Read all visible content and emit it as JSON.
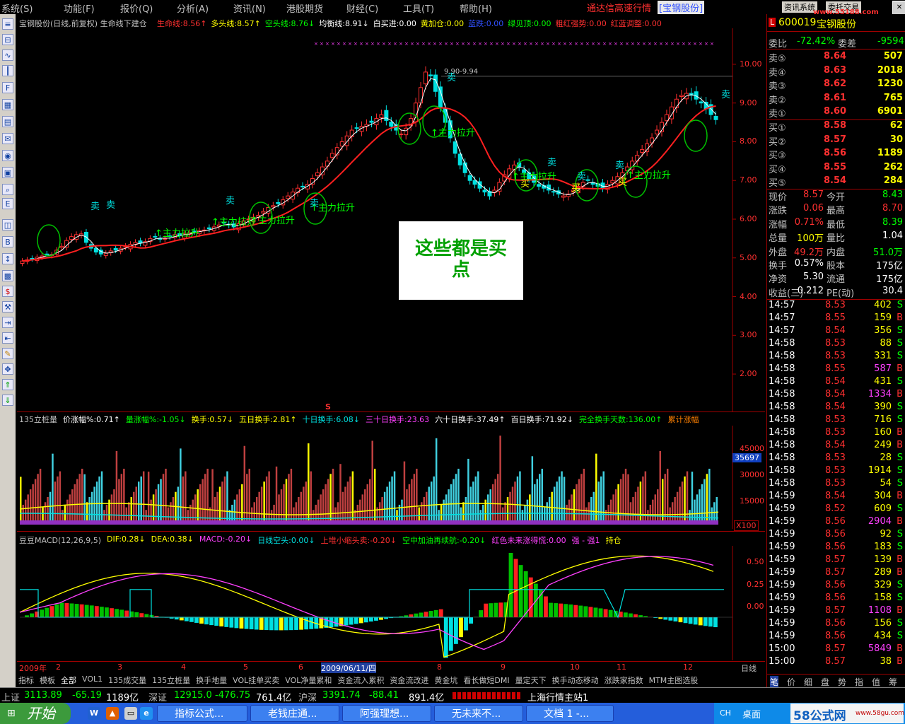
{
  "menu": {
    "items": [
      "系统(S)",
      "功能(F)",
      "报价(Q)",
      "分析(A)",
      "资讯(N)",
      "港股期货",
      "财经(C)",
      "工具(T)",
      "帮助(H)"
    ],
    "brand": "通达信高速行情",
    "stock_tag": "[宝钢股份]",
    "top_buttons": [
      "资讯系统",
      "委托交易"
    ],
    "watermark": "www.55188.com"
  },
  "colors": {
    "up": "#ff3030",
    "down": "#00e0e0",
    "bg": "#000000",
    "ma_yellow": "#ffff00",
    "life_line": "#ff2020"
  },
  "main_chart": {
    "header": "宝钢股份(日线,前复权) 生命线下建仓",
    "indicators": [
      {
        "text": "生命线:8.56↑",
        "color": "#ff3030"
      },
      {
        "text": "多头线:8.57↑",
        "color": "#ffff00"
      },
      {
        "text": "空头线:8.76↓",
        "color": "#00ff00"
      },
      {
        "text": "均衡线:8.91↓",
        "color": "#ffffff"
      },
      {
        "text": "白买进:0.00",
        "color": "#ffffff"
      },
      {
        "text": "黄加仓:0.00",
        "color": "#ffff00"
      },
      {
        "text": "蓝跌:0.00",
        "color": "#3050ff"
      },
      {
        "text": "绿见顶:0.00",
        "color": "#00ff00"
      },
      {
        "text": "粗红强势:0.00",
        "color": "#ff3030"
      },
      {
        "text": "红蓝调整:0.00",
        "color": "#ff3030"
      }
    ],
    "y_ticks": [
      "10.00",
      "9.00",
      "8.00",
      "7.00",
      "6.00",
      "5.00",
      "4.00",
      "3.00",
      "2.00"
    ],
    "peak_label": "9.90-9.94",
    "annotation": [
      "这些都是买",
      "点"
    ],
    "labels": {
      "main_up": "主力拉升",
      "sell": "卖",
      "buy": "买",
      "s_marker": "S"
    }
  },
  "chart_data": [
    {
      "type": "candlestick",
      "title": "宝钢股份(日线,前复权)",
      "ylim": [
        1.8,
        10.2
      ],
      "closes": [
        4.92,
        4.95,
        4.98,
        5.02,
        5.05,
        5.1,
        5.08,
        5.2,
        5.3,
        5.45,
        5.55,
        5.6,
        5.62,
        5.4,
        5.25,
        5.15,
        5.1,
        5.12,
        5.18,
        5.2,
        5.25,
        5.3,
        5.35,
        5.4,
        5.38,
        5.42,
        5.5,
        5.55,
        5.48,
        5.5,
        5.55,
        5.6,
        5.58,
        5.62,
        5.65,
        5.68,
        5.7,
        5.72,
        5.75,
        5.8,
        5.85,
        5.9,
        5.85,
        5.8,
        5.88,
        5.95,
        6.0,
        6.05,
        6.1,
        6.2,
        6.3,
        6.35,
        6.4,
        6.5,
        6.6,
        6.7,
        6.8,
        6.85,
        6.9,
        7.05,
        7.2,
        7.35,
        7.5,
        7.7,
        7.85,
        8.0,
        8.15,
        8.3,
        8.35,
        8.4,
        8.45,
        8.5,
        8.6,
        8.7,
        8.55,
        8.4,
        8.3,
        8.2,
        8.35,
        8.6,
        9.0,
        9.4,
        9.8,
        9.7,
        9.3,
        8.9,
        8.5,
        8.1,
        7.7,
        7.4,
        7.2,
        7.0,
        6.9,
        6.8,
        6.7,
        6.6,
        6.75,
        6.95,
        7.15,
        7.3,
        7.4,
        7.35,
        7.2,
        7.05,
        6.95,
        6.85,
        6.8,
        6.75,
        6.7,
        6.65,
        6.6,
        6.65,
        6.75,
        6.85,
        6.95,
        7.0,
        6.9,
        6.85,
        6.8,
        6.9,
        7.0,
        7.1,
        7.2,
        7.35,
        7.5,
        7.65,
        7.8,
        7.95,
        8.1,
        8.3,
        8.5,
        8.7,
        8.9,
        9.1,
        9.2,
        9.25,
        9.2,
        9.1,
        9.0,
        8.85,
        8.7,
        8.57
      ],
      "ma_fast_label": "多头线",
      "life_line_label": "生命线"
    },
    {
      "type": "bar",
      "title": "135立桩量",
      "ylim": [
        0,
        50000
      ],
      "y_ticks": [
        "45000",
        "30000",
        "15000"
      ],
      "current_value": "35697",
      "scale_label": "X100"
    },
    {
      "type": "bar",
      "title": "豆豆MACD(12,26,9,5)",
      "ylim": [
        -0.35,
        0.65
      ],
      "y_ticks": [
        "0.50",
        "0.25",
        "0.00"
      ]
    }
  ],
  "volume_panel": {
    "header": [
      {
        "text": "135立桩量",
        "color": "#c0c0c0"
      },
      {
        "text": "价涨幅%:0.71↑",
        "color": "#ffffff"
      },
      {
        "text": "量涨幅%:-1.05↓",
        "color": "#00ff00"
      },
      {
        "text": "换手:0.57↓",
        "color": "#ffff00"
      },
      {
        "text": "五日换手:2.81↑",
        "color": "#ffff00"
      },
      {
        "text": "十日换手:6.08↓",
        "color": "#00e0e0"
      },
      {
        "text": "三十日换手:23.63",
        "color": "#ff40ff"
      },
      {
        "text": "六十日换手:37.49↑",
        "color": "#ffffff"
      },
      {
        "text": "百日换手:71.92↓",
        "color": "#ffffff"
      },
      {
        "text": "完全换手天数:136.00↑",
        "color": "#00ff00"
      },
      {
        "text": "累计涨幅",
        "color": "#ff8000"
      }
    ]
  },
  "macd_panel": {
    "header": [
      {
        "text": "豆豆MACD(12,26,9,5)",
        "color": "#c0c0c0"
      },
      {
        "text": "DIF:0.28↓",
        "color": "#ffff00"
      },
      {
        "text": "DEA:0.38↓",
        "color": "#ffff00"
      },
      {
        "text": "MACD:-0.20↓",
        "color": "#ff40ff"
      },
      {
        "text": "日线空头:0.00↓",
        "color": "#00e0e0"
      },
      {
        "text": "上堆小缩头卖:-0.20↓",
        "color": "#ff3030"
      },
      {
        "text": "空中加油再续航:-0.20↓",
        "color": "#00ff00"
      },
      {
        "text": "红色未来涨得慌:0.00",
        "color": "#ff40ff"
      },
      {
        "text": "强 - 强1",
        "color": "#ff40ff"
      },
      {
        "text": "持仓",
        "color": "#ffff00"
      }
    ]
  },
  "x_axis": {
    "labels": [
      "2009年",
      "2",
      "3",
      "4",
      "5",
      "6",
      "2009/06/11/四",
      "8",
      "9",
      "10",
      "11",
      "12"
    ],
    "period": "日线"
  },
  "bottom_tabs": [
    "指标",
    "模板",
    "全部",
    "VOL1",
    "135成交量",
    "135立桩量",
    "换手地量",
    "VOL挂单买卖",
    "VOL净量累和",
    "资金流入累积",
    "资金流改进",
    "黄金坑",
    "看长做短DMI",
    "量定天下",
    "换手动态移动",
    "涨跌家指数",
    "MTM主图选股"
  ],
  "right_panel": {
    "code": "600019",
    "name": "宝钢股份",
    "weibi": {
      "label": "委比",
      "value": "-72.42%",
      "label2": "委差",
      "value2": "-9594"
    },
    "asks": [
      {
        "label": "卖⑤",
        "price": "8.64",
        "vol": "507"
      },
      {
        "label": "卖④",
        "price": "8.63",
        "vol": "2018"
      },
      {
        "label": "卖③",
        "price": "8.62",
        "vol": "1230"
      },
      {
        "label": "卖②",
        "price": "8.61",
        "vol": "765"
      },
      {
        "label": "卖①",
        "price": "8.60",
        "vol": "6901"
      }
    ],
    "bids": [
      {
        "label": "买①",
        "price": "8.58",
        "vol": "62"
      },
      {
        "label": "买②",
        "price": "8.57",
        "vol": "30"
      },
      {
        "label": "买③",
        "price": "8.56",
        "vol": "1189"
      },
      {
        "label": "买④",
        "price": "8.55",
        "vol": "262"
      },
      {
        "label": "买⑤",
        "price": "8.54",
        "vol": "284"
      }
    ],
    "stats": [
      {
        "l1": "现价",
        "v1": "8.57",
        "c1": "#ff3030",
        "l2": "今开",
        "v2": "8.43",
        "c2": "#00ff00"
      },
      {
        "l1": "涨跌",
        "v1": "0.06",
        "c1": "#ff3030",
        "l2": "最高",
        "v2": "8.70",
        "c2": "#ff3030"
      },
      {
        "l1": "涨幅",
        "v1": "0.71%",
        "c1": "#ff3030",
        "l2": "最低",
        "v2": "8.39",
        "c2": "#00ff00"
      },
      {
        "l1": "总量",
        "v1": "100万",
        "c1": "#ffff00",
        "l2": "量比",
        "v2": "1.04",
        "c2": "#ffffff"
      },
      {
        "l1": "外盘",
        "v1": "49.2万",
        "c1": "#ff3030",
        "l2": "内盘",
        "v2": "51.0万",
        "c2": "#00ff00"
      },
      {
        "l1": "换手",
        "v1": "0.57%",
        "c1": "#ffffff",
        "l2": "股本",
        "v2": "175亿",
        "c2": "#ffffff"
      },
      {
        "l1": "净资",
        "v1": "5.30",
        "c1": "#ffffff",
        "l2": "流通",
        "v2": "175亿",
        "c2": "#ffffff"
      },
      {
        "l1": "收益(三)",
        "v1": "0.212",
        "c1": "#ffffff",
        "l2": "PE(动)",
        "v2": "30.4",
        "c2": "#ffffff"
      }
    ],
    "ticks": [
      {
        "t": "14:57",
        "p": "8.53",
        "v": "402",
        "s": "S"
      },
      {
        "t": "14:57",
        "p": "8.55",
        "v": "159",
        "s": "B"
      },
      {
        "t": "14:57",
        "p": "8.54",
        "v": "356",
        "s": "S"
      },
      {
        "t": "14:58",
        "p": "8.53",
        "v": "88",
        "s": "S"
      },
      {
        "t": "14:58",
        "p": "8.53",
        "v": "331",
        "s": "S"
      },
      {
        "t": "14:58",
        "p": "8.55",
        "v": "587",
        "s": "B"
      },
      {
        "t": "14:58",
        "p": "8.54",
        "v": "431",
        "s": "S"
      },
      {
        "t": "14:58",
        "p": "8.54",
        "v": "1334",
        "s": "B"
      },
      {
        "t": "14:58",
        "p": "8.54",
        "v": "390",
        "s": "S"
      },
      {
        "t": "14:58",
        "p": "8.53",
        "v": "716",
        "s": "S"
      },
      {
        "t": "14:58",
        "p": "8.53",
        "v": "160",
        "s": "B"
      },
      {
        "t": "14:58",
        "p": "8.54",
        "v": "249",
        "s": "B"
      },
      {
        "t": "14:58",
        "p": "8.53",
        "v": "28",
        "s": "S"
      },
      {
        "t": "14:58",
        "p": "8.53",
        "v": "1914",
        "s": "S"
      },
      {
        "t": "14:58",
        "p": "8.53",
        "v": "54",
        "s": "S"
      },
      {
        "t": "14:59",
        "p": "8.54",
        "v": "304",
        "s": "B"
      },
      {
        "t": "14:59",
        "p": "8.52",
        "v": "609",
        "s": "S"
      },
      {
        "t": "14:59",
        "p": "8.56",
        "v": "2904",
        "s": "B"
      },
      {
        "t": "14:59",
        "p": "8.56",
        "v": "92",
        "s": "S"
      },
      {
        "t": "14:59",
        "p": "8.56",
        "v": "183",
        "s": "S"
      },
      {
        "t": "14:59",
        "p": "8.57",
        "v": "139",
        "s": "B"
      },
      {
        "t": "14:59",
        "p": "8.57",
        "v": "289",
        "s": "B"
      },
      {
        "t": "14:59",
        "p": "8.56",
        "v": "329",
        "s": "S"
      },
      {
        "t": "14:59",
        "p": "8.56",
        "v": "158",
        "s": "S"
      },
      {
        "t": "14:59",
        "p": "8.57",
        "v": "1108",
        "s": "B"
      },
      {
        "t": "14:59",
        "p": "8.56",
        "v": "156",
        "s": "S"
      },
      {
        "t": "14:59",
        "p": "8.56",
        "v": "434",
        "s": "S"
      },
      {
        "t": "15:00",
        "p": "8.57",
        "v": "5849",
        "s": "B"
      },
      {
        "t": "15:00",
        "p": "8.57",
        "v": "38",
        "s": "B"
      }
    ],
    "tabs": [
      "笔",
      "价",
      "细",
      "盘",
      "势",
      "指",
      "值",
      "筹"
    ]
  },
  "status_bar": {
    "sh_label": "上证",
    "sh_value": "3113.89",
    "sh_change": "-65.19",
    "sh_amount": "1189亿",
    "sz_label": "深证",
    "sz_value": "12915.0",
    "sz_change": "-476.75",
    "sz_amount": "761.4亿",
    "hs_label": "沪深",
    "hs_value": "3391.74",
    "hs_change": "-88.41",
    "hs_amount": "891.4亿",
    "server": "上海行情主站1"
  },
  "taskbar": {
    "start": "开始",
    "tasks": [
      "指标公式...",
      "老钱庄通...",
      "阿强理想...",
      "无未来不...",
      "文档 1 -..."
    ],
    "tray_text": [
      "CH",
      "桌面"
    ],
    "site_logo": "58公式网",
    "site_url": "www.58gu.com"
  }
}
